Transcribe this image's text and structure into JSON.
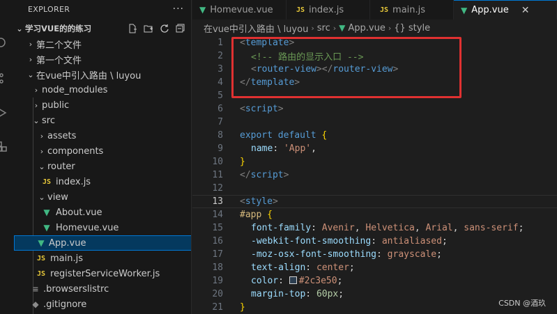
{
  "sidebar": {
    "header": "EXPLORER",
    "more": "···",
    "project": "学习VUE的的练习",
    "tree": [
      {
        "label": "第二个文件",
        "chevron": "›",
        "icon": ""
      },
      {
        "label": "第一个文件",
        "chevron": "›",
        "icon": ""
      },
      {
        "label": "在vue中引入路由 \\ luyou",
        "chevron": "⌄",
        "icon": ""
      },
      {
        "label": "node_modules",
        "chevron": "›",
        "icon": ""
      },
      {
        "label": "public",
        "chevron": "›",
        "icon": ""
      },
      {
        "label": "src",
        "chevron": "⌄",
        "icon": ""
      },
      {
        "label": "assets",
        "chevron": "›",
        "icon": ""
      },
      {
        "label": "components",
        "chevron": "›",
        "icon": ""
      },
      {
        "label": "router",
        "chevron": "⌄",
        "icon": ""
      },
      {
        "label": "index.js",
        "chevron": "",
        "icon": "JS"
      },
      {
        "label": "view",
        "chevron": "⌄",
        "icon": ""
      },
      {
        "label": "About.vue",
        "chevron": "",
        "icon": "V"
      },
      {
        "label": "Homevue.vue",
        "chevron": "",
        "icon": "V"
      },
      {
        "label": "App.vue",
        "chevron": "",
        "icon": "V"
      },
      {
        "label": "main.js",
        "chevron": "",
        "icon": "JS"
      },
      {
        "label": "registerServiceWorker.js",
        "chevron": "",
        "icon": "JS"
      },
      {
        "label": ".browserslistrc",
        "chevron": "",
        "icon": "≡"
      },
      {
        "label": ".gitignore",
        "chevron": "",
        "icon": "◆"
      }
    ]
  },
  "tabs": [
    {
      "label": "Homevue.vue",
      "icon": "V"
    },
    {
      "label": "index.js",
      "icon": "JS"
    },
    {
      "label": "main.js",
      "icon": "JS"
    },
    {
      "label": "App.vue",
      "icon": "V",
      "close": "✕"
    }
  ],
  "breadcrumb": [
    "在vue中引入路由 \\ luyou",
    "src",
    "App.vue",
    "{} style"
  ],
  "editor": {
    "line_numbers": [
      "1",
      "2",
      "3",
      "4",
      "5",
      "6",
      "7",
      "8",
      "9",
      "10",
      "11",
      "12",
      "13",
      "14",
      "15",
      "16",
      "17",
      "18",
      "19",
      "20",
      "21"
    ],
    "active_line": "13",
    "lines": {
      "l1": {
        "open": "<",
        "tag": "template",
        "close": ">"
      },
      "l2": {
        "comment": "<!-- 路由的显示入口 -->"
      },
      "l3": {
        "a": "<",
        "tag": "router-view",
        "b": "></",
        "tag2": "router-view",
        "c": ">"
      },
      "l4": {
        "open": "</",
        "tag": "template",
        "close": ">"
      },
      "l6": {
        "open": "<",
        "tag": "script",
        "close": ">"
      },
      "l8": {
        "kw1": "export",
        "kw2": "default",
        "brace": "{"
      },
      "l9": {
        "prop": "name",
        "colon": ": ",
        "str": "'App'",
        "comma": ","
      },
      "l10": {
        "brace": "}"
      },
      "l11": {
        "open": "</",
        "tag": "script",
        "close": ">"
      },
      "l13": {
        "open": "<",
        "tag": "style",
        "close": ">"
      },
      "l14": {
        "sel": "#app",
        "brace": "{"
      },
      "l15": {
        "prop": "font-family",
        "colon": ": ",
        "v1": "Avenir",
        "c1": ", ",
        "v2": "Helvetica",
        "c2": ", ",
        "v3": "Arial",
        "c3": ", ",
        "v4": "sans-serif",
        "semi": ";"
      },
      "l16": {
        "prop": "-webkit-font-smoothing",
        "colon": ": ",
        "val": "antialiased",
        "semi": ";"
      },
      "l17": {
        "prop": "-moz-osx-font-smoothing",
        "colon": ": ",
        "val": "grayscale",
        "semi": ";"
      },
      "l18": {
        "prop": "text-align",
        "colon": ": ",
        "val": "center",
        "semi": ";"
      },
      "l19": {
        "prop": "color",
        "colon": ": ",
        "val": "#2c3e50",
        "semi": ";"
      },
      "l20": {
        "prop": "margin-top",
        "colon": ": ",
        "val": "60px",
        "semi": ";"
      },
      "l21": {
        "brace": "}"
      }
    }
  },
  "watermark": "CSDN @酒玖",
  "colors": {
    "accent": "#0078d4",
    "highlight_border": "#e03131",
    "swatch": "#2c3e50"
  }
}
